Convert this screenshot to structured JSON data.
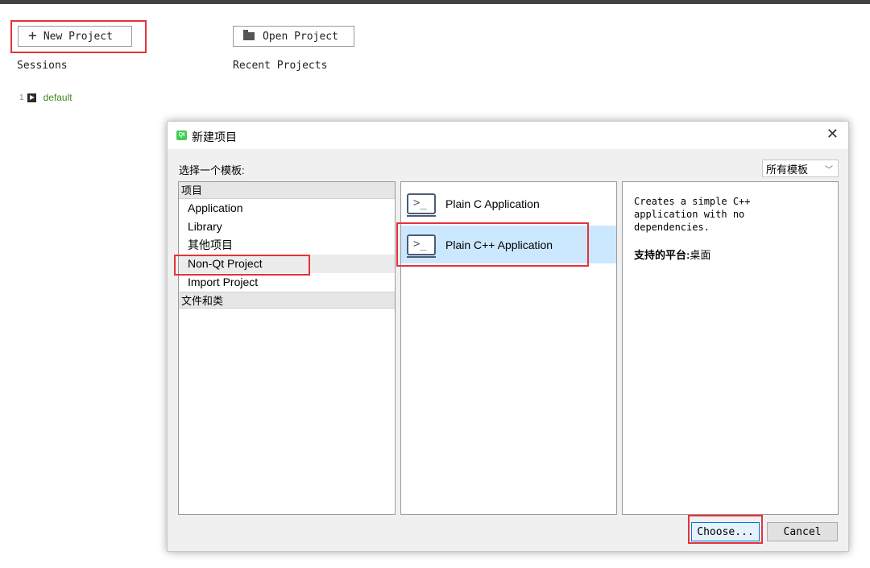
{
  "welcome": {
    "new_project_label": "New Project",
    "open_project_label": "Open Project",
    "sessions_heading": "Sessions",
    "recent_projects_heading": "Recent Projects",
    "sessions": [
      {
        "index": "1",
        "name": "default"
      }
    ]
  },
  "dialog": {
    "title": "新建项目",
    "choose_template_label": "选择一个模板:",
    "filter_select": "所有模板",
    "categories": [
      {
        "type": "header",
        "label": "项目"
      },
      {
        "type": "item",
        "label": "Application"
      },
      {
        "type": "item",
        "label": "Library"
      },
      {
        "type": "item",
        "label": "其他项目"
      },
      {
        "type": "item",
        "label": "Non-Qt Project",
        "selected": true
      },
      {
        "type": "item",
        "label": "Import Project"
      },
      {
        "type": "header",
        "label": "文件和类"
      }
    ],
    "templates": [
      {
        "label": "Plain C Application",
        "selected": false
      },
      {
        "label": "Plain C++ Application",
        "selected": true
      }
    ],
    "description": "Creates a simple C++\napplication with no\ndependencies.",
    "platform_label": "支持的平台:",
    "platform_value": "桌面",
    "choose_button": "Choose...",
    "cancel_button": "Cancel"
  },
  "colors": {
    "annotation_red": "#e5323b",
    "selection_blue": "#cce8ff",
    "session_green": "#3c8a1e",
    "topbar": "#404244"
  },
  "icons": [
    "plus-icon",
    "folder-icon",
    "play-icon",
    "qt-logo-icon",
    "close-icon",
    "chevron-down-icon",
    "terminal-icon"
  ]
}
